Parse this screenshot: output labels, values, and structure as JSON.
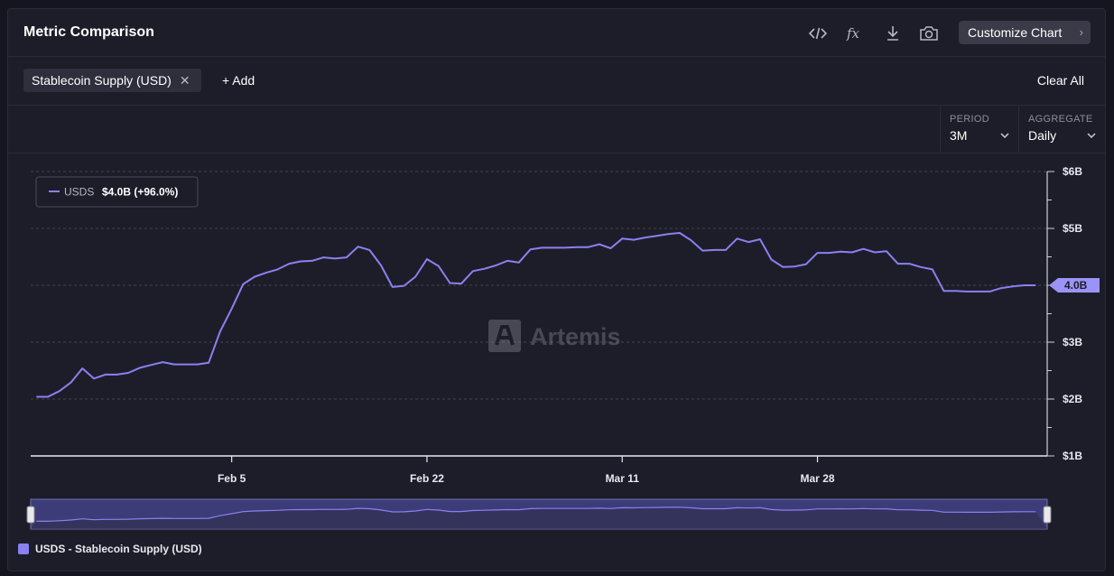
{
  "header": {
    "title": "Metric Comparison",
    "customize_label": "Customize Chart",
    "icons": [
      "code-icon",
      "formula-icon",
      "download-icon",
      "camera-icon"
    ]
  },
  "metrics": {
    "chip_label": "Stablecoin Supply (USD)",
    "add_label": "+ Add",
    "clear_label": "Clear All"
  },
  "controls": {
    "period_label": "PERIOD",
    "period_value": "3M",
    "aggregate_label": "AGGREGATE",
    "aggregate_value": "Daily"
  },
  "tooltip": {
    "series": "USDS",
    "value": "$4.0B (+96.0%)"
  },
  "watermark": "Artemis",
  "current_value_badge": "4.0B",
  "legend": {
    "label": "USDS - Stablecoin Supply (USD)"
  },
  "colors": {
    "series": "#8a80f0",
    "background": "#1d1d29",
    "grid": "#44444f"
  },
  "chart_data": {
    "type": "line",
    "y_tick_labels": [
      "$1B",
      "$2B",
      "$3B",
      "$4B",
      "$5B",
      "$6B"
    ],
    "x_tick_labels": [
      "Feb 5",
      "Feb 22",
      "Mar 11",
      "Mar 28"
    ],
    "x_ticks": [
      {
        "label": "Feb 5",
        "day": 17
      },
      {
        "label": "Feb 22",
        "day": 34
      },
      {
        "label": "Mar 11",
        "day": 51
      },
      {
        "label": "Mar 28",
        "day": 68
      }
    ],
    "ylim": [
      1,
      6
    ],
    "xlim": [
      -0.5,
      88
    ],
    "grid": true,
    "series": [
      {
        "name": "USDS",
        "x": [
          0,
          1,
          2,
          3,
          4,
          5,
          6,
          7,
          8,
          9,
          10,
          11,
          12,
          13,
          14,
          15,
          16,
          17,
          18,
          19,
          20,
          21,
          22,
          23,
          24,
          25,
          26,
          27,
          28,
          29,
          30,
          31,
          32,
          33,
          34,
          35,
          36,
          37,
          38,
          39,
          40,
          41,
          42,
          43,
          44,
          45,
          46,
          47,
          48,
          49,
          50,
          51,
          52,
          53,
          54,
          55,
          56,
          57,
          58,
          59,
          60,
          61,
          62,
          63,
          64,
          65,
          66,
          67,
          68,
          69,
          70,
          71,
          72,
          73,
          74,
          75,
          76,
          77,
          78,
          79,
          80,
          81,
          82,
          83,
          84,
          85,
          86,
          87
        ],
        "values": [
          2.04,
          2.04,
          2.14,
          2.29,
          2.54,
          2.36,
          2.43,
          2.43,
          2.46,
          2.55,
          2.6,
          2.65,
          2.61,
          2.61,
          2.61,
          2.64,
          3.19,
          3.59,
          4.02,
          4.15,
          4.22,
          4.28,
          4.38,
          4.42,
          4.43,
          4.49,
          4.47,
          4.49,
          4.68,
          4.62,
          4.35,
          3.97,
          3.99,
          4.15,
          4.46,
          4.34,
          4.04,
          4.03,
          4.25,
          4.29,
          4.35,
          4.43,
          4.4,
          4.63,
          4.66,
          4.66,
          4.66,
          4.67,
          4.67,
          4.72,
          4.65,
          4.82,
          4.8,
          4.84,
          4.87,
          4.9,
          4.92,
          4.79,
          4.61,
          4.62,
          4.62,
          4.82,
          4.76,
          4.81,
          4.45,
          4.32,
          4.33,
          4.37,
          4.57,
          4.57,
          4.59,
          4.58,
          4.64,
          4.58,
          4.6,
          4.38,
          4.38,
          4.32,
          4.28,
          3.9,
          3.9,
          3.89,
          3.89,
          3.89,
          3.95,
          3.98,
          4.0,
          4.0
        ]
      }
    ]
  }
}
